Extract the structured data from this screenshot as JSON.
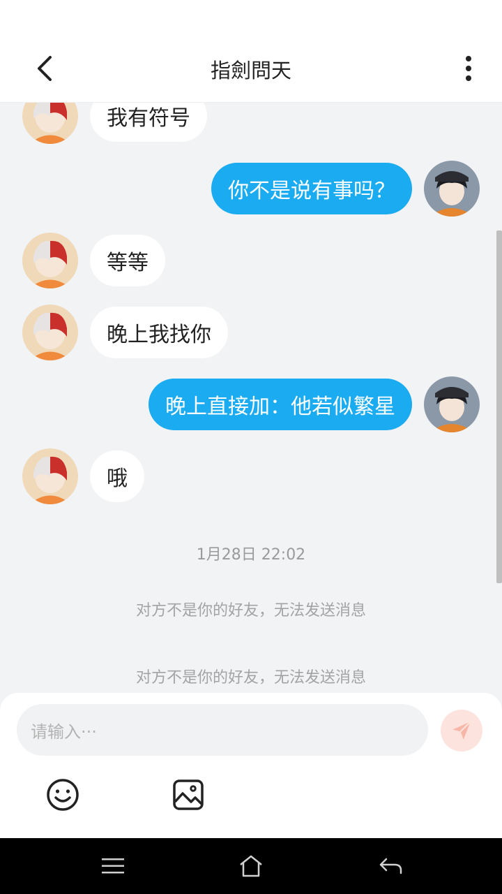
{
  "header": {
    "title": "指劍問天"
  },
  "messages": [
    {
      "side": "left",
      "text": "我有符号"
    },
    {
      "side": "right",
      "text": "你不是说有事吗？"
    },
    {
      "side": "left",
      "text": "等等"
    },
    {
      "side": "left",
      "text": "晚上我找你"
    },
    {
      "side": "right",
      "text": "晚上直接加：他若似繁星"
    },
    {
      "side": "left",
      "text": "哦"
    }
  ],
  "timestamp": "1月28日 22:02",
  "system_notes": [
    "对方不是你的好友，无法发送消息",
    "对方不是你的好友，无法发送消息"
  ],
  "composer": {
    "placeholder": "请输入···"
  },
  "colors": {
    "accent": "#1aabf0",
    "send_button_bg": "#fde3dd",
    "page_bg": "#f2f3f5"
  },
  "icons": {
    "back": "chevron-left-icon",
    "more": "more-vertical-icon",
    "send": "paper-plane-icon",
    "emoji": "smiley-icon",
    "image": "image-icon",
    "nav_menu": "menu-icon",
    "nav_home": "home-icon",
    "nav_back": "back-arrow-icon"
  }
}
